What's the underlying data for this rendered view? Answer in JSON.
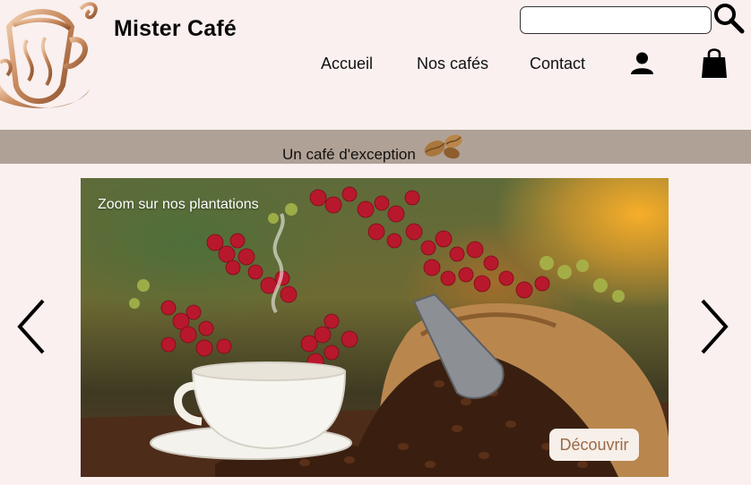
{
  "header": {
    "brand": "Mister Café",
    "search": {
      "value": "",
      "placeholder": ""
    },
    "nav": [
      {
        "label": "Accueil"
      },
      {
        "label": "Nos cafés"
      },
      {
        "label": "Contact"
      }
    ],
    "icons": [
      "search-icon",
      "user-icon",
      "shopping-bag-icon"
    ]
  },
  "tagline": {
    "text": "Un café d'exception",
    "icon": "coffee-beans-icon"
  },
  "carousel": {
    "caption": "Zoom sur nos plantations",
    "cta_label": "Découvrir",
    "controls": [
      "chevron-left-icon",
      "chevron-right-icon"
    ]
  },
  "colors": {
    "page_background": "#f9f0ef",
    "band": "#b0a196",
    "logo_bronze": "#c98a5e",
    "cta_text": "#9a6a48"
  }
}
